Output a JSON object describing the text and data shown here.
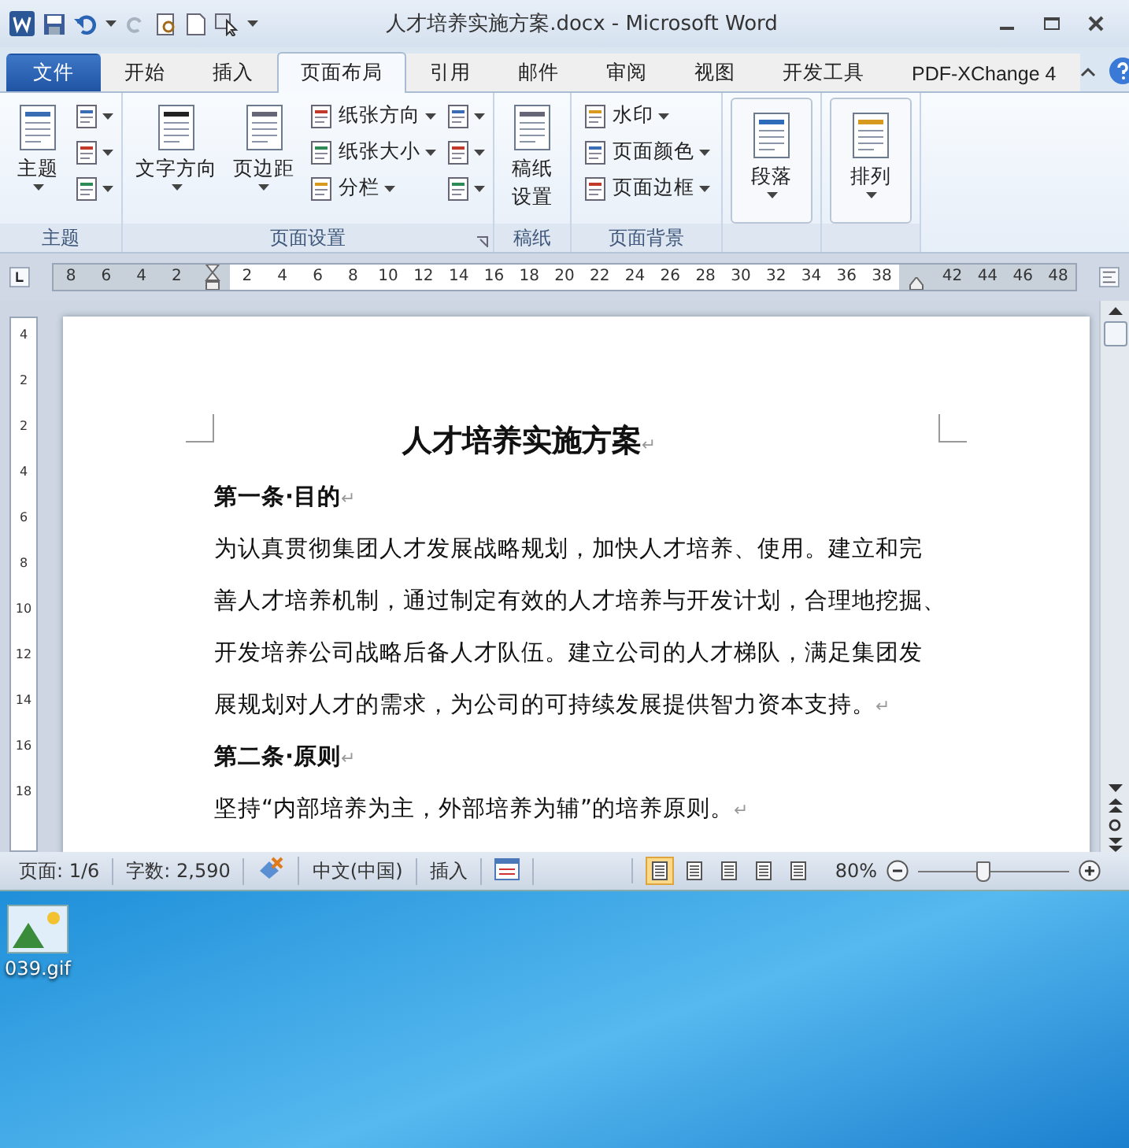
{
  "window": {
    "title": "人才培养实施方案.docx - Microsoft Word"
  },
  "tabs": [
    {
      "label": "文件",
      "kind": "file",
      "selected": false
    },
    {
      "label": "开始",
      "kind": "tab",
      "selected": false
    },
    {
      "label": "插入",
      "kind": "tab",
      "selected": false
    },
    {
      "label": "页面布局",
      "kind": "tab",
      "selected": true
    },
    {
      "label": "引用",
      "kind": "tab",
      "selected": false
    },
    {
      "label": "邮件",
      "kind": "tab",
      "selected": false
    },
    {
      "label": "审阅",
      "kind": "tab",
      "selected": false
    },
    {
      "label": "视图",
      "kind": "tab",
      "selected": false
    },
    {
      "label": "开发工具",
      "kind": "tab",
      "selected": false
    },
    {
      "label": "PDF-XChange 4",
      "kind": "tab",
      "selected": false
    }
  ],
  "ribbon_groups": [
    {
      "label": "主题",
      "items": [
        {
          "kind": "large",
          "lines": [
            "主题"
          ],
          "dropdown": true
        },
        {
          "kind": "icons"
        }
      ]
    },
    {
      "label": "页面设置",
      "launcher": true,
      "items": [
        {
          "kind": "large",
          "lines": [
            "文字方向"
          ],
          "dropdown": true
        },
        {
          "kind": "large",
          "lines": [
            "页边距"
          ],
          "dropdown": true
        },
        {
          "kind": "small",
          "labels": [
            "纸张方向",
            "纸张大小",
            "分栏"
          ]
        },
        {
          "kind": "icons"
        }
      ]
    },
    {
      "label": "稿纸",
      "items": [
        {
          "kind": "large",
          "lines": [
            "稿纸",
            "设置"
          ]
        }
      ]
    },
    {
      "label": "页面背景",
      "items": [
        {
          "kind": "small",
          "labels": [
            "水印",
            "页面颜色",
            "页面边框"
          ]
        }
      ]
    },
    {
      "items": [
        {
          "kind": "large",
          "lines": [
            "段落"
          ],
          "dropdown": true
        }
      ]
    },
    {
      "items": [
        {
          "kind": "large",
          "lines": [
            "排列"
          ],
          "dropdown": true
        }
      ]
    }
  ],
  "ruler": {
    "left_numbers": [
      "8",
      "6",
      "4",
      "2"
    ],
    "numbers": [
      "2",
      "4",
      "6",
      "8",
      "10",
      "12",
      "14",
      "16",
      "18",
      "20",
      "22",
      "24",
      "26",
      "28",
      "30",
      "32",
      "34",
      "36",
      "38"
    ],
    "right_numbers": [
      "42",
      "44",
      "46",
      "48"
    ]
  },
  "vertical_ruler": {
    "numbers": [
      "4",
      "2",
      "2",
      "4",
      "6",
      "8",
      "10",
      "12",
      "14",
      "16",
      "18"
    ]
  },
  "document": {
    "paragraphs": [
      {
        "kind": "title",
        "lines": [
          "人才培养实施方案"
        ],
        "end_mark": "↵"
      },
      {
        "kind": "heading",
        "lines": [
          "第一条·目的"
        ],
        "end_mark": "↵"
      },
      {
        "kind": "body",
        "lines": [
          "为认真贯彻集团人才发展战略规划，加快人才培养、使用。建立和完",
          "善人才培养机制，通过制定有效的人才培养与开发计划，合理地挖掘、",
          "开发培养公司战略后备人才队伍。建立公司的人才梯队，满足集团发",
          "展规划对人才的需求，为公司的可持续发展提供智力资本支持。"
        ],
        "end_mark": "↵"
      },
      {
        "kind": "heading",
        "lines": [
          "第二条·原则"
        ],
        "end_mark": "↵"
      },
      {
        "kind": "body",
        "lines": [
          "坚持“内部培养为主，外部培养为辅”的培养原则。"
        ],
        "end_mark": "↵"
      }
    ]
  },
  "status_bar": {
    "page": "页面: 1/6",
    "words": "字数: 2,590",
    "language": "中文(中国)",
    "mode": "插入",
    "views": [
      {
        "selected": true
      },
      {
        "selected": false
      },
      {
        "selected": false
      },
      {
        "selected": false
      },
      {
        "selected": false
      }
    ],
    "zoom": "80%",
    "zoom_level": {
      "level": 0.43
    }
  },
  "desktop": {
    "icons": [
      {
        "label": "039.gif"
      }
    ]
  }
}
